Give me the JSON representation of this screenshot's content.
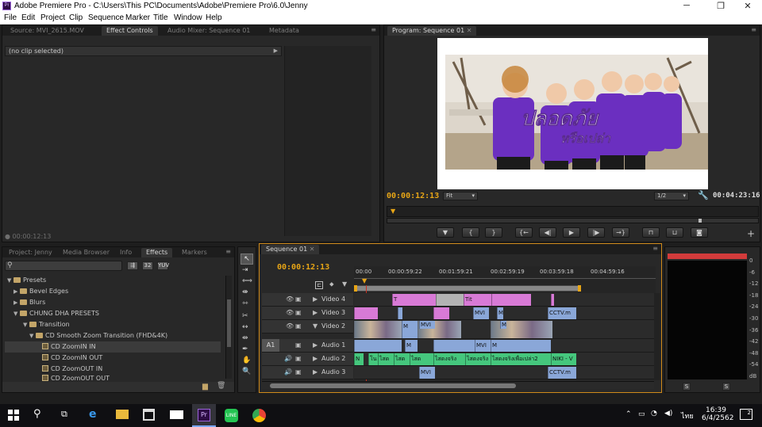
{
  "window": {
    "app_name": "Adobe Premiere Pro",
    "title": "Adobe Premiere Pro - C:\\Users\\This PC\\Documents\\Adobe\\Premiere Pro\\6.0\\Jenny",
    "logo_text": "Pr",
    "controls": [
      "─",
      "❐",
      "✕"
    ]
  },
  "menu": [
    "File",
    "Edit",
    "Project",
    "Clip",
    "Sequence",
    "Marker",
    "Title",
    "Window",
    "Help"
  ],
  "source_panel": {
    "tabs": [
      "Source: MVI_2615.MOV",
      "Effect Controls",
      "Audio Mixer: Sequence 01",
      "Metadata"
    ],
    "active_tab": "Effect Controls",
    "no_clip": "(no clip selected)",
    "timecode": "00:00:12:13"
  },
  "program_monitor": {
    "tab": "Program: Sequence 01",
    "timecode_current": "00:00:12:13",
    "zoom": "Fit",
    "resolution": "1/2",
    "timecode_duration": "00:04:23:16",
    "overlay_text_line1": "ปลอดภัย",
    "overlay_text_line2": "หรือเปล่า",
    "colors": {
      "shirt": "#6b2fc0",
      "sky": "#e6e0d8",
      "ground": "#b4a48a"
    }
  },
  "project_panel": {
    "tabs": [
      "Project: Jenny",
      "Media Browser",
      "Info",
      "Effects",
      "Markers"
    ],
    "active_tab": "Effects",
    "tree": [
      {
        "label": "Presets",
        "level": 0,
        "type": "folder",
        "open": true
      },
      {
        "label": "Bevel Edges",
        "level": 1,
        "type": "folder",
        "open": false
      },
      {
        "label": "Blurs",
        "level": 1,
        "type": "folder",
        "open": false
      },
      {
        "label": "CHUNG DHA PRESETS",
        "level": 1,
        "type": "folder",
        "open": true
      },
      {
        "label": "Transition",
        "level": 2,
        "type": "folder",
        "open": true
      },
      {
        "label": "CD Smooth Zoom Transition (FHD&4K)",
        "level": 3,
        "type": "folder",
        "open": true
      },
      {
        "label": "CD ZoomIN IN",
        "level": 4,
        "type": "effect",
        "selected": true
      },
      {
        "label": "CD ZoomIN OUT",
        "level": 4,
        "type": "effect"
      },
      {
        "label": "CD ZoomOUT IN",
        "level": 4,
        "type": "effect"
      },
      {
        "label": "CD ZoomOUT OUT",
        "level": 4,
        "type": "effect"
      }
    ]
  },
  "timeline": {
    "tab": "Sequence 01",
    "timecode": "00:00:12:13",
    "ruler": [
      "00:00",
      "00:00:59:22",
      "00:01:59:21",
      "00:02:59:19",
      "00:03:59:18",
      "00:04:59:16"
    ],
    "tracks": [
      {
        "name": "Video 4",
        "kind": "video"
      },
      {
        "name": "Video 3",
        "kind": "video"
      },
      {
        "name": "Video 2",
        "kind": "video"
      },
      {
        "name": "Audio 1",
        "kind": "audio",
        "target": "A1"
      },
      {
        "name": "Audio 2",
        "kind": "audio"
      },
      {
        "name": "Audio 3",
        "kind": "audio"
      }
    ],
    "clip_labels": {
      "mvi": "MVI",
      "mvi_short": "M",
      "cctv": "CCTV.m",
      "tit": "Tit",
      "t": "T",
      "niki": "NIKI - V",
      "n": "N",
      "thai1": "โน",
      "thai2": "ไสด",
      "thai3": "ไสดงจริง",
      "thai4": "ไสดงจริงเพื่อเปล่า2"
    }
  },
  "audio_meter": {
    "scale": [
      "0",
      "-6",
      "-12",
      "-18",
      "-24",
      "-30",
      "-36",
      "-42",
      "-48",
      "-54",
      "dB"
    ],
    "solo": [
      "S",
      "S"
    ]
  },
  "taskbar": {
    "time": "16:39",
    "date": "6/4/2562",
    "lang": "ไทย",
    "notifications": "2"
  }
}
